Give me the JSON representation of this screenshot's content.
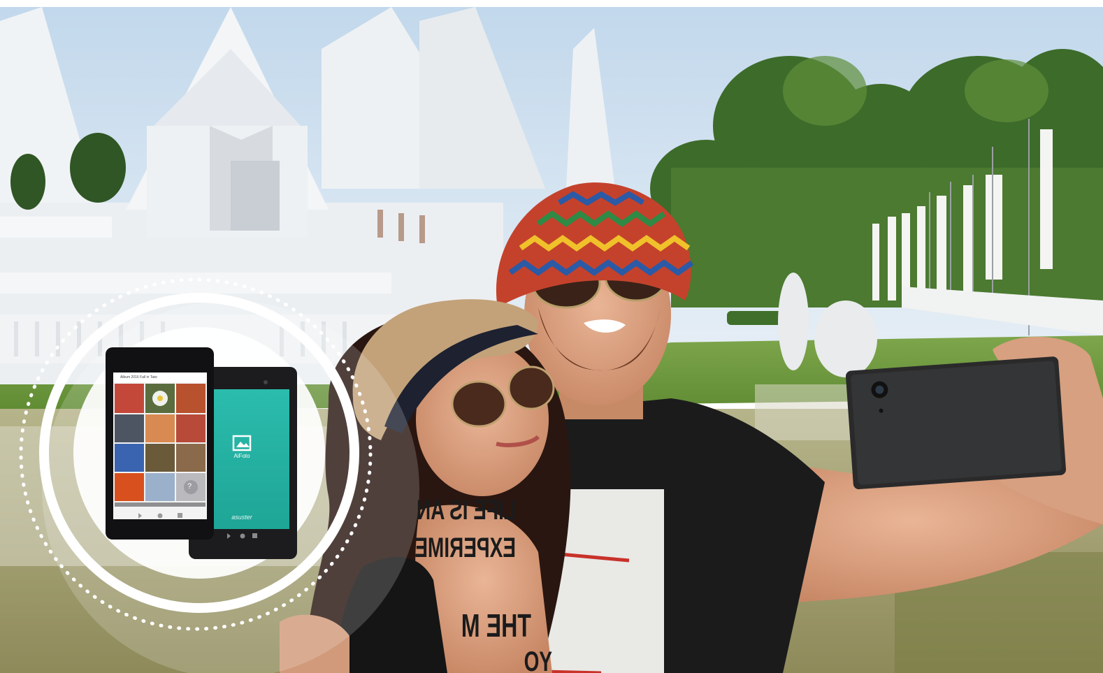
{
  "scene": {
    "description_colors": {
      "sky": "#cfe0ee",
      "temple": "#eef1f4",
      "grass": "#6f9a3e",
      "water": "#9c9a6a",
      "teal_screen": "#25b3a5",
      "circle": "#ffffff"
    }
  },
  "tablet_back": {
    "app_name": "AiFoto",
    "brand": "asuster"
  },
  "tablet_front": {
    "header_title": "Album 2016 Fall in Taiw"
  },
  "shirt": {
    "line1": "LIFE IS AN",
    "line2": "EXPERIME",
    "line3": "THE M",
    "line4": "YO"
  }
}
